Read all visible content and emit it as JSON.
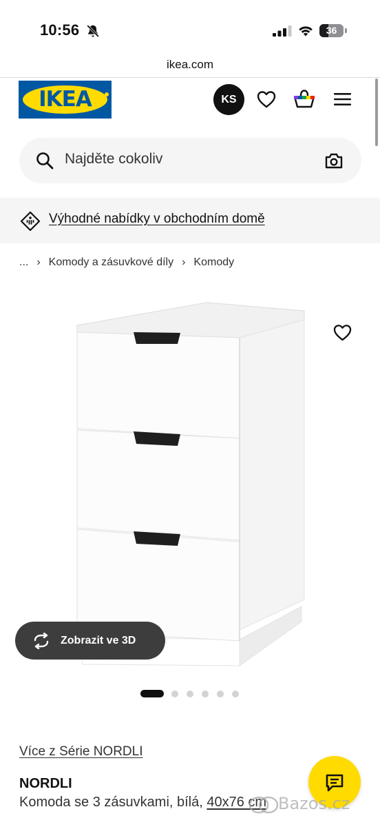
{
  "status_bar": {
    "time": "10:56",
    "battery_level": "36",
    "battery_fraction": 0.36,
    "icons": [
      "bell-slash-icon",
      "cellular-signal-icon",
      "wifi-icon",
      "battery-icon"
    ]
  },
  "browser": {
    "url": "ikea.com"
  },
  "header": {
    "logo_text": "IKEA",
    "avatar_initials": "KS",
    "icons": [
      "heart-icon",
      "shopping-bag-icon",
      "hamburger-menu-icon"
    ]
  },
  "search": {
    "placeholder": "Najděte cokoliv",
    "icons": [
      "search-icon",
      "camera-icon"
    ]
  },
  "offer_banner": {
    "text": "Výhodné nabídky v obchodním domě",
    "icon": "price-tag-icon"
  },
  "breadcrumb": {
    "items": [
      "...",
      "Komody a zásuvkové díly",
      "Komody"
    ]
  },
  "product_gallery": {
    "view_3d_label": "Zobrazit ve 3D",
    "image_count": 6,
    "active_index": 0
  },
  "product": {
    "series_link": "Více z Série NORDLI",
    "name": "NORDLI",
    "description": "Komoda se 3 zásuvkami, bílá,",
    "dimensions": "40x76 cm"
  },
  "chat": {
    "icon": "chat-bubble-icon"
  },
  "watermark": {
    "text": "Bazos.cz"
  },
  "colors": {
    "ikea_blue": "#0058a3",
    "ikea_yellow": "#ffdb00",
    "banner_bg": "#f5f5f5",
    "button_dark": "#2d2d2d"
  }
}
